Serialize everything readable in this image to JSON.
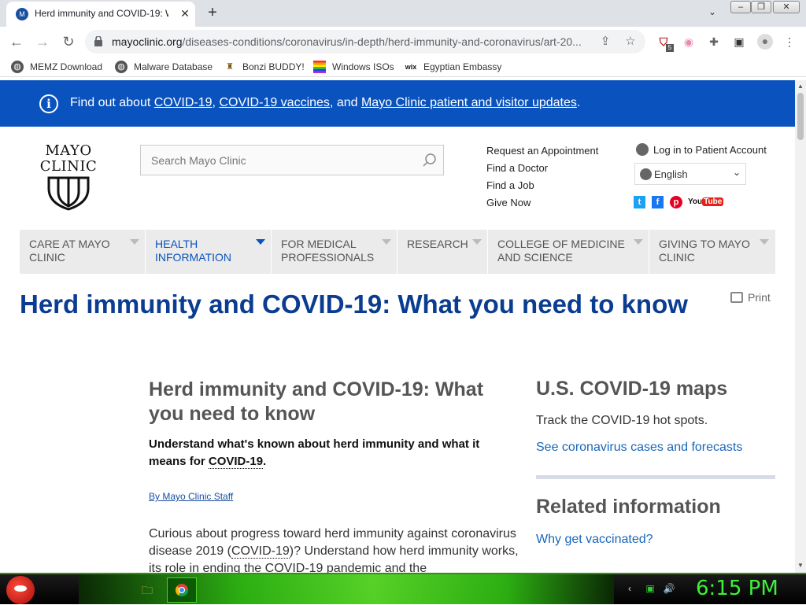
{
  "browser": {
    "tab_title": "Herd immunity and COVID-19: W",
    "url_host": "mayoclinic.org",
    "url_path": "/diseases-conditions/coronavirus/in-depth/herd-immunity-and-coronavirus/art-20...",
    "extension_badge": "5",
    "bookmarks": [
      {
        "label": "MEMZ Download",
        "icon": "globe-icon"
      },
      {
        "label": "Malware Database",
        "icon": "globe-icon"
      },
      {
        "label": "Bonzi BUDDY!",
        "icon": "bonzi-icon"
      },
      {
        "label": "Windows ISOs",
        "icon": "windows-icon"
      },
      {
        "label": "Egyptian Embassy",
        "icon": "wix-icon"
      }
    ]
  },
  "banner": {
    "prefix": "Find out about ",
    "link1": "COVID-19",
    "sep1": ", ",
    "link2": "COVID-19 vaccines",
    "sep2": ", and ",
    "link3": "Mayo Clinic patient and visitor updates",
    "suffix": "."
  },
  "header": {
    "logo_line1": "MAYO",
    "logo_line2": "CLINIC",
    "search_placeholder": "Search Mayo Clinic",
    "links": [
      "Request an Appointment",
      "Find a Doctor",
      "Find a Job",
      "Give Now"
    ],
    "login": "Log in to Patient Account",
    "language": "English",
    "social": [
      "twitter-icon",
      "facebook-icon",
      "pinterest-icon",
      "youtube-icon"
    ],
    "youtube_label": "YouTube"
  },
  "nav": [
    {
      "line1": "CARE AT MAYO",
      "line2": "CLINIC",
      "active": false
    },
    {
      "line1": "HEALTH",
      "line2": "INFORMATION",
      "active": true
    },
    {
      "line1": "FOR MEDICAL",
      "line2": "PROFESSIONALS",
      "active": false
    },
    {
      "line1": "RESEARCH",
      "line2": "",
      "active": false
    },
    {
      "line1": "COLLEGE OF MEDICINE",
      "line2": "AND SCIENCE",
      "active": false
    },
    {
      "line1": "GIVING TO MAYO",
      "line2": "CLINIC",
      "active": false
    }
  ],
  "main": {
    "page_title": "Herd immunity and COVID-19: What you need to know",
    "print_label": "Print",
    "article_title": "Herd immunity and COVID-19: What you need to know",
    "subtitle_prefix": "Understand what's known about herd immunity and what it means for ",
    "subtitle_term": "COVID-19",
    "subtitle_suffix": ".",
    "byline": "By Mayo Clinic Staff",
    "body_part1": "Curious about progress toward herd immunity against coronavirus disease 2019 (",
    "body_term": "COVID-19",
    "body_part2": ")? Understand how herd immunity works, its role in ending the COVID-19 pandemic and the"
  },
  "sidebar": {
    "maps_title": "U.S. COVID-19 maps",
    "maps_text": "Track the COVID-19 hot spots.",
    "maps_link": "See coronavirus cases and forecasts",
    "related_title": "Related information",
    "related_link": "Why get vaccinated?"
  },
  "taskbar": {
    "clock": "6:15 PM"
  },
  "colors": {
    "banner_blue": "#0a53be",
    "title_blue": "#0a3d91",
    "link_blue": "#1a66b8",
    "clock_green": "#3ff03a"
  }
}
